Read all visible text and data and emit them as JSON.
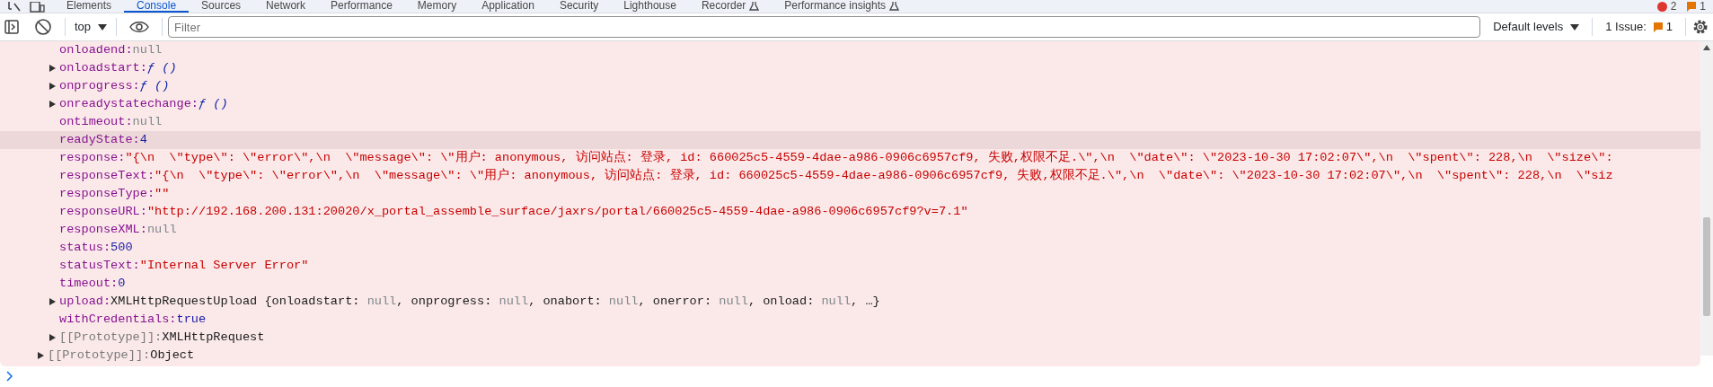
{
  "tabs": [
    {
      "label": "Elements",
      "selected": false,
      "beta": false
    },
    {
      "label": "Console",
      "selected": true,
      "beta": false
    },
    {
      "label": "Sources",
      "selected": false,
      "beta": false
    },
    {
      "label": "Network",
      "selected": false,
      "beta": false
    },
    {
      "label": "Performance",
      "selected": false,
      "beta": false
    },
    {
      "label": "Memory",
      "selected": false,
      "beta": false
    },
    {
      "label": "Application",
      "selected": false,
      "beta": false
    },
    {
      "label": "Security",
      "selected": false,
      "beta": false
    },
    {
      "label": "Lighthouse",
      "selected": false,
      "beta": false
    },
    {
      "label": "Recorder",
      "selected": false,
      "beta": true
    },
    {
      "label": "Performance insights",
      "selected": false,
      "beta": true
    }
  ],
  "counters": {
    "errors": "2",
    "warnings": "1"
  },
  "toolbar": {
    "context": "top",
    "filter": {
      "placeholder": "Filter"
    },
    "levels": "Default levels",
    "issues": {
      "label": "1 Issue:",
      "count": "1"
    }
  },
  "object": {
    "entries": [
      {
        "key": "onloadend:",
        "internal": false,
        "value": "null",
        "kind": "null",
        "expandable": false,
        "highlighted": false
      },
      {
        "key": "onloadstart:",
        "internal": false,
        "value": "ƒ ()",
        "kind": "function",
        "expandable": true,
        "highlighted": false
      },
      {
        "key": "onprogress:",
        "internal": false,
        "value": "ƒ ()",
        "kind": "function",
        "expandable": true,
        "highlighted": false
      },
      {
        "key": "onreadystatechange:",
        "internal": false,
        "value": "ƒ ()",
        "kind": "function",
        "expandable": true,
        "highlighted": false
      },
      {
        "key": "ontimeout:",
        "internal": false,
        "value": "null",
        "kind": "null",
        "expandable": false,
        "highlighted": false
      },
      {
        "key": "readyState:",
        "internal": false,
        "value": "4",
        "kind": "number",
        "expandable": false,
        "highlighted": true
      },
      {
        "key": "response:",
        "internal": false,
        "value": "\"{\\n  \\\"type\\\": \\\"error\\\",\\n  \\\"message\\\": \\\"用户: anonymous, 访问站点: 登录, id: 660025c5-4559-4dae-a986-0906c6957cf9, 失败,权限不足.\\\",\\n  \\\"date\\\": \\\"2023-10-30 17:02:07\\\",\\n  \\\"spent\\\": 228,\\n  \\\"size\\\":",
        "kind": "string",
        "expandable": false,
        "highlighted": false
      },
      {
        "key": "responseText:",
        "internal": false,
        "value": "\"{\\n  \\\"type\\\": \\\"error\\\",\\n  \\\"message\\\": \\\"用户: anonymous, 访问站点: 登录, id: 660025c5-4559-4dae-a986-0906c6957cf9, 失败,权限不足.\\\",\\n  \\\"date\\\": \\\"2023-10-30 17:02:07\\\",\\n  \\\"spent\\\": 228,\\n  \\\"siz",
        "kind": "string",
        "expandable": false,
        "highlighted": false
      },
      {
        "key": "responseType:",
        "internal": false,
        "value": "\"\"",
        "kind": "string",
        "expandable": false,
        "highlighted": false
      },
      {
        "key": "responseURL:",
        "internal": false,
        "value": "\"http://192.168.200.131:20020/x_portal_assemble_surface/jaxrs/portal/660025c5-4559-4dae-a986-0906c6957cf9?v=7.1\"",
        "kind": "string",
        "expandable": false,
        "highlighted": false
      },
      {
        "key": "responseXML:",
        "internal": false,
        "value": "null",
        "kind": "null",
        "expandable": false,
        "highlighted": false
      },
      {
        "key": "status:",
        "internal": false,
        "value": "500",
        "kind": "number",
        "expandable": false,
        "highlighted": false
      },
      {
        "key": "statusText:",
        "internal": false,
        "value": "\"Internal Server Error\"",
        "kind": "string",
        "expandable": false,
        "highlighted": false
      },
      {
        "key": "timeout:",
        "internal": false,
        "value": "0",
        "kind": "number",
        "expandable": false,
        "highlighted": false
      },
      {
        "key": "upload:",
        "internal": false,
        "kind": "preview",
        "expandable": true,
        "highlighted": false,
        "segments": [
          {
            "text": "XMLHttpRequestUpload {onloadstart: ",
            "kind": "object"
          },
          {
            "text": "null",
            "kind": "null"
          },
          {
            "text": ", onprogress: ",
            "kind": "object"
          },
          {
            "text": "null",
            "kind": "null"
          },
          {
            "text": ", onabort: ",
            "kind": "object"
          },
          {
            "text": "null",
            "kind": "null"
          },
          {
            "text": ", onerror: ",
            "kind": "object"
          },
          {
            "text": "null",
            "kind": "null"
          },
          {
            "text": ", onload: ",
            "kind": "object"
          },
          {
            "text": "null",
            "kind": "null"
          },
          {
            "text": ", …}",
            "kind": "object"
          }
        ]
      },
      {
        "key": "withCredentials:",
        "internal": false,
        "value": "true",
        "kind": "number",
        "expandable": false,
        "highlighted": false
      },
      {
        "key": "[[Prototype]]:",
        "internal": true,
        "value": "XMLHttpRequest",
        "kind": "object",
        "expandable": true,
        "highlighted": false
      }
    ],
    "prototype": {
      "key": "[[Prototype]]:",
      "internal": true,
      "value": "Object",
      "kind": "object",
      "expandable": true,
      "highlighted": false
    }
  }
}
